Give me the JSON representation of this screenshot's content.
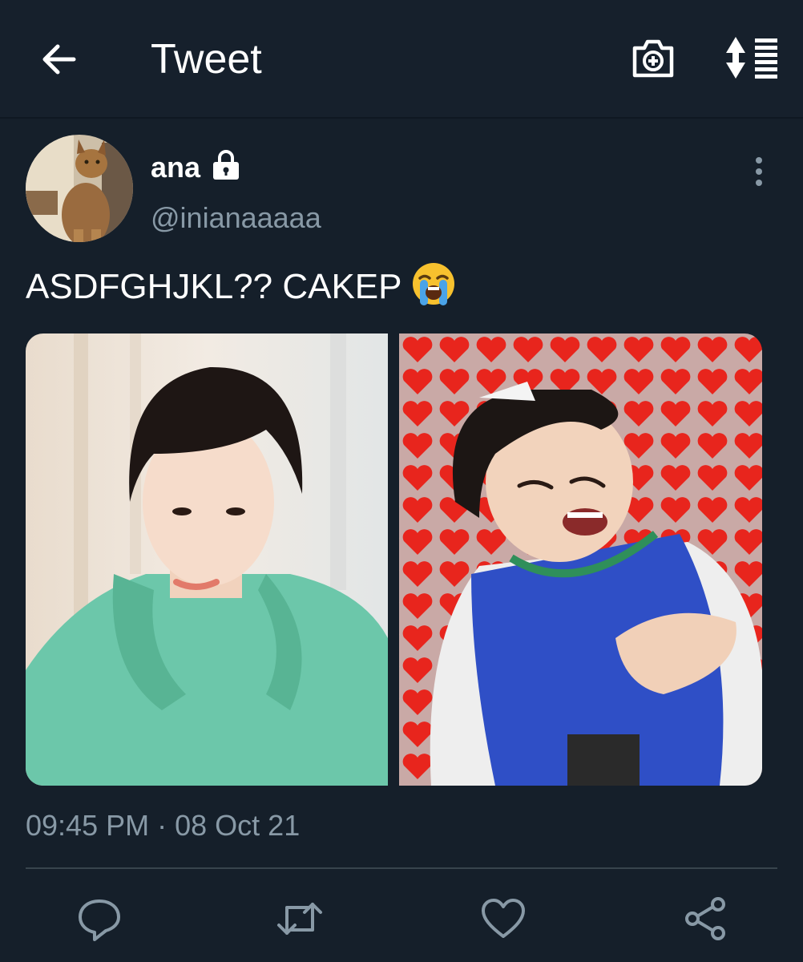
{
  "header": {
    "title": "Tweet",
    "back_icon": "arrow-left-icon",
    "camera_icon": "camera-add-icon",
    "sort_icon": "sort-toggle-icon"
  },
  "tweet": {
    "author_name": "ana",
    "author_handle": "@inianaaaaa",
    "protected_icon": "lock-icon",
    "text": "ASDFGHJKL?? CAKEP",
    "emoji": "loudly-crying-face",
    "timestamp_time": "09:45 PM",
    "timestamp_sep": "·",
    "timestamp_date": "08 Oct 21",
    "media": [
      {
        "description_icon": "photo-icon"
      },
      {
        "description_icon": "photo-icon"
      }
    ]
  },
  "actions": [
    "reply-icon",
    "retweet-icon",
    "like-icon",
    "share-icon"
  ],
  "colors": {
    "background": "#151f2a",
    "muted_text": "#8899a6",
    "divider": "#38444d",
    "text": "#ffffff"
  }
}
